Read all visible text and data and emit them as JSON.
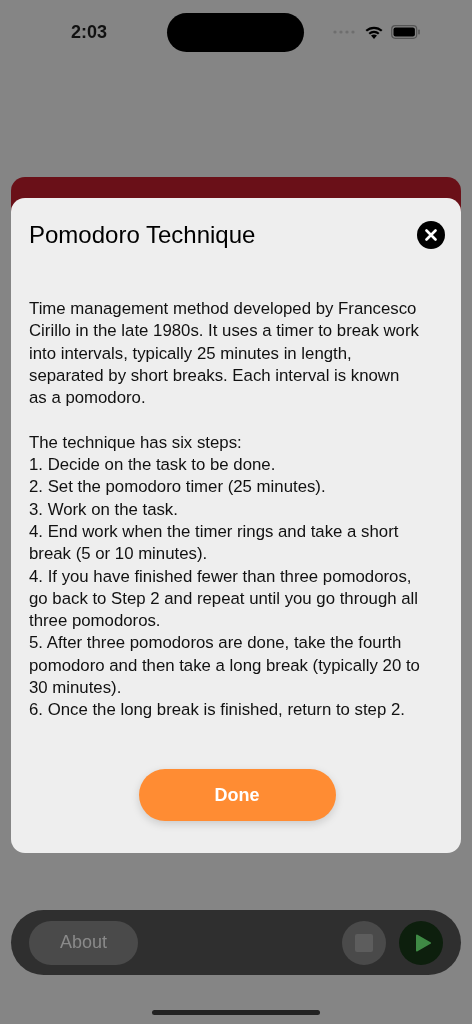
{
  "status_bar": {
    "time": "2:03"
  },
  "sheet": {
    "title": "Pomodoro Technique",
    "paragraphs": [
      "Time management method developed by Francesco Cirillo in the late 1980s. It uses a timer to break work into intervals, typically 25 minutes in length, separated by short breaks. Each interval is known as a pomodoro."
    ],
    "steps_heading": "The technique has six steps:",
    "steps": [
      "1. Decide on the task to be done.",
      "2. Set the pomodoro timer (25 minutes).",
      "3. Work on the task.",
      "4. End work when the timer rings and take a short break (5 or 10 minutes).",
      "4. If you have finished fewer than three pomodoros, go back to Step 2 and repeat until you go through all three pomodoros.",
      "5. After three pomodoros are done, take the fourth pomodoro and then take a long break (typically 20 to 30 minutes).",
      "6. Once the long break is finished, return to step 2."
    ],
    "done_button": "Done"
  },
  "bottom_bar": {
    "about_button": "About",
    "stop_disabled": true,
    "playing": false
  }
}
